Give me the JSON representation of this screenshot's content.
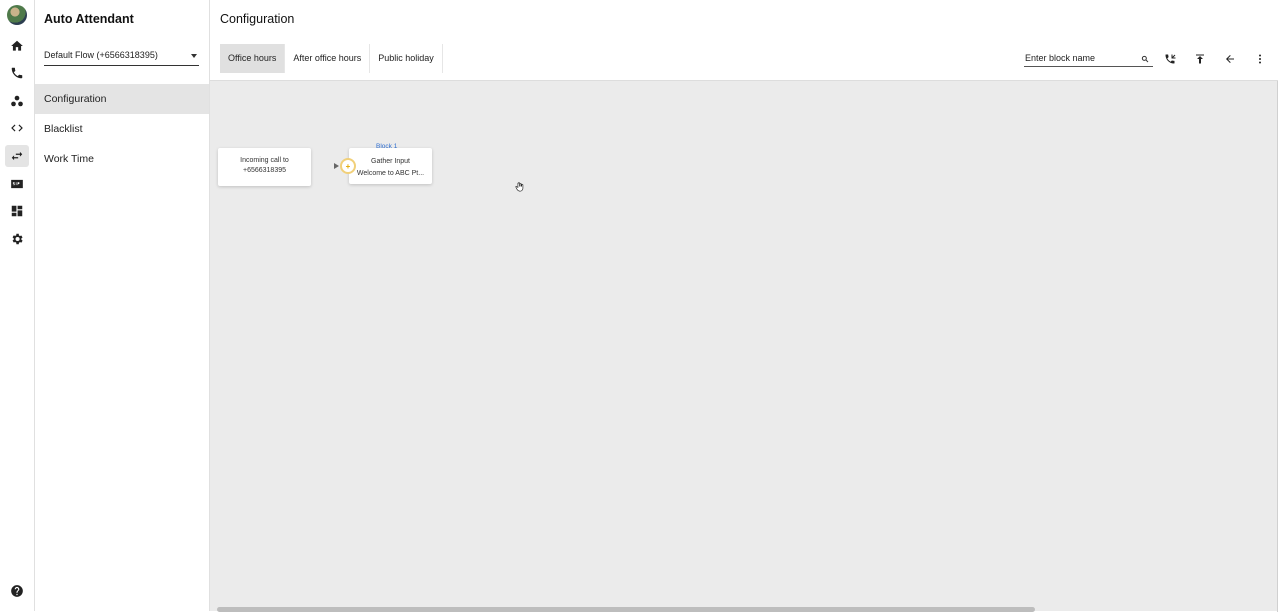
{
  "rail": {
    "items": [
      {
        "name": "home-icon"
      },
      {
        "name": "phone-icon"
      },
      {
        "name": "users-icon"
      },
      {
        "name": "code-icon"
      },
      {
        "name": "swap-icon",
        "active": true
      },
      {
        "name": "sip-icon"
      },
      {
        "name": "dashboard-icon"
      },
      {
        "name": "settings-icon"
      },
      {
        "name": "help-icon"
      }
    ]
  },
  "sidebar": {
    "title": "Auto Attendant",
    "flow_select": "Default Flow (+6566318395)",
    "items": [
      {
        "label": "Configuration",
        "active": true
      },
      {
        "label": "Blacklist"
      },
      {
        "label": "Work Time"
      }
    ]
  },
  "main": {
    "title": "Configuration",
    "tabs": [
      {
        "label": "Office hours",
        "active": true
      },
      {
        "label": "After office hours"
      },
      {
        "label": "Public holiday"
      }
    ],
    "search_placeholder": "Enter block name"
  },
  "canvas": {
    "start_block": {
      "line1": "Incoming call to",
      "line2": "+6566318395"
    },
    "gather_block": {
      "label": "Block 1",
      "line1": "Gather Input",
      "line2": "Welcome to ABC Pt..."
    }
  }
}
